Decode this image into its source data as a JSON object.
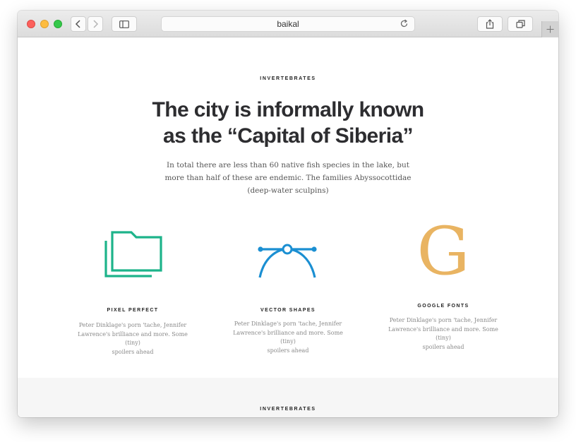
{
  "browser": {
    "url_text": "baikal",
    "icons": [
      "back-icon",
      "forward-icon",
      "sidebar-icon",
      "reload-icon",
      "share-icon",
      "tabs-icon",
      "plus-icon"
    ]
  },
  "page": {
    "eyebrow": "INVERTEBRATES",
    "headline_line1": "The city is informally known",
    "headline_line2": "as the “Capital of Siberia”",
    "lead_line1": "In total there are less than 60 native fish species in the lake, but",
    "lead_line2": "more than half of these are endemic. The families Abyssocottidae",
    "lead_line3": "(deep-water sculpins)",
    "features": [
      {
        "icon": "folder-icon",
        "title": "PIXEL PERFECT",
        "line1": "Peter Dinklage's porn 'tache, Jennifer",
        "line2": "Lawrence's brilliance and more. Some (tiny)",
        "line3": "spoilers ahead"
      },
      {
        "icon": "bezier-pen-icon",
        "title": "VECTOR SHAPES",
        "line1": "Peter Dinklage's porn 'tache, Jennifer",
        "line2": "Lawrence's brilliance and more. Some (tiny)",
        "line3": "spoilers ahead"
      },
      {
        "icon": "google-g-icon",
        "glyph": "G",
        "title": "GOOGLE FONTS",
        "line1": "Peter Dinklage's porn 'tache, Jennifer",
        "line2": "Lawrence's brilliance and more. Some (tiny)",
        "line3": "spoilers ahead"
      }
    ],
    "footer_eyebrow": "INVERTEBRATES"
  },
  "colors": {
    "folder": "#1db38a",
    "vector": "#1b8fd2",
    "google": "#e9b462",
    "headline": "#2d2d30"
  }
}
